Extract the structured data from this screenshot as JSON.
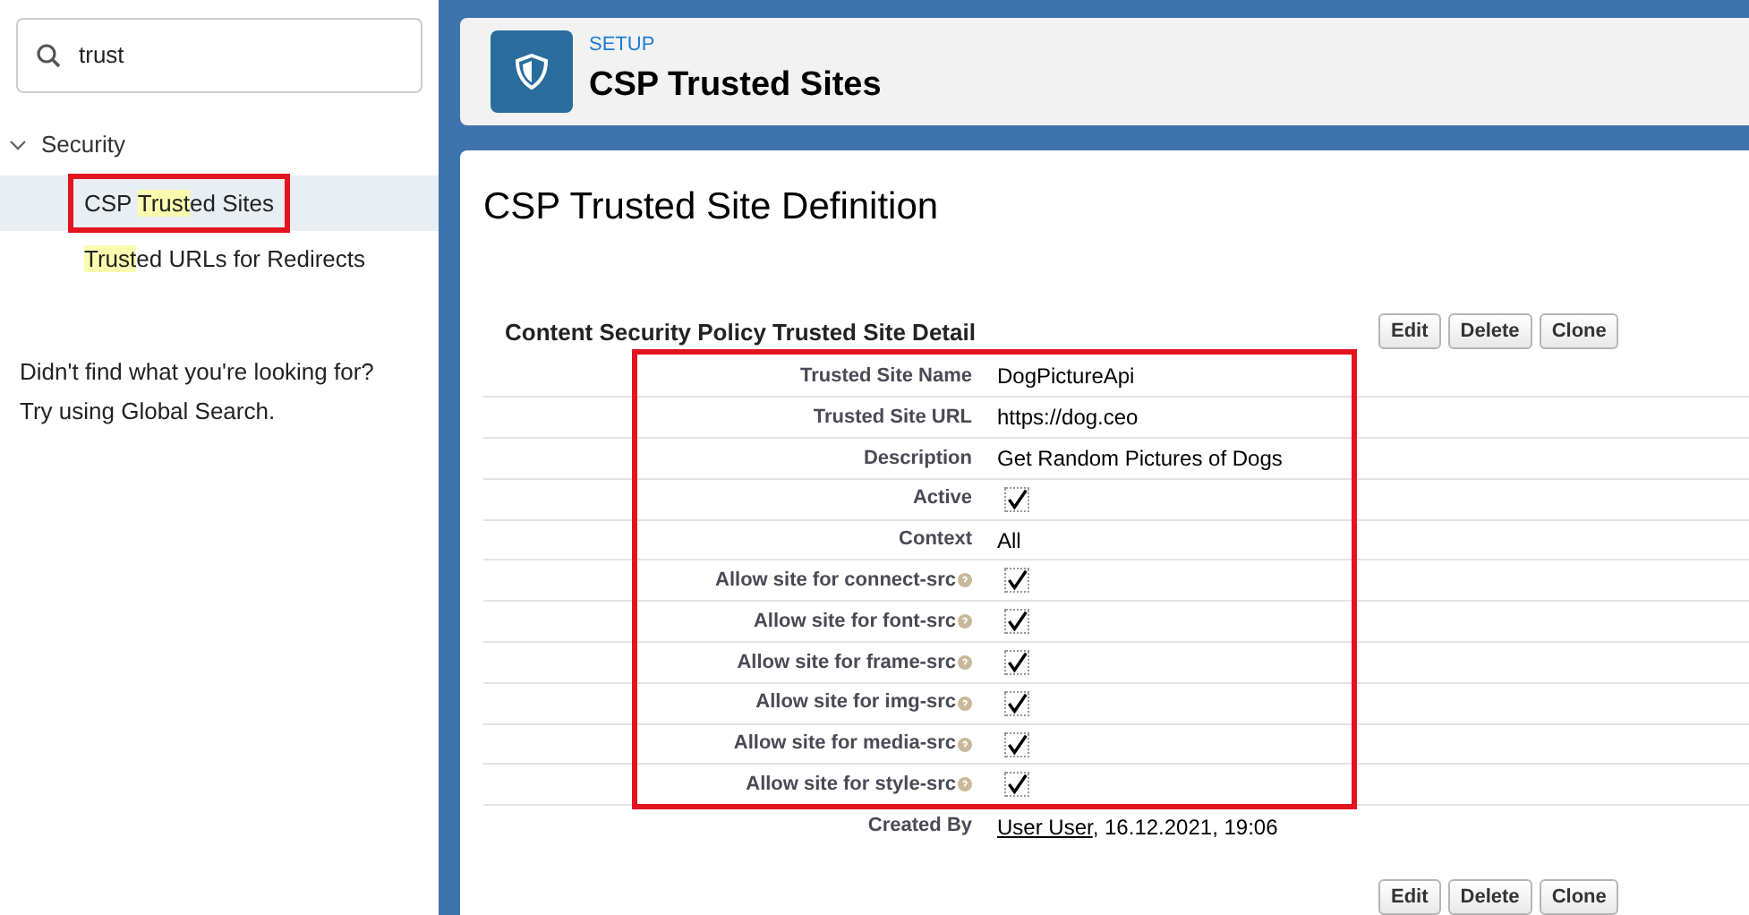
{
  "sidebar": {
    "search": {
      "value": "trust"
    },
    "tree": [
      {
        "label": "Security",
        "expanded": true,
        "children": [
          {
            "before": "CSP ",
            "match": "Trust",
            "after": "ed Sites",
            "selected": true,
            "outlined": true
          },
          {
            "match": "Trust",
            "after": "ed URLs for Redirects",
            "selected": false,
            "outlined": false
          }
        ]
      }
    ],
    "help_lines": [
      "Didn't find what you're looking for?",
      "Try using Global Search."
    ]
  },
  "header": {
    "eyebrow": "SETUP",
    "title": "CSP Trusted Sites"
  },
  "page_title": "CSP Trusted Site Definition",
  "detail": {
    "title": "Content Security Policy Trusted Site Detail",
    "buttons": [
      "Edit",
      "Delete",
      "Clone"
    ],
    "rows": [
      {
        "kind": "text",
        "label": "Trusted Site Name",
        "value": "DogPictureApi",
        "help": false,
        "outlined": true
      },
      {
        "kind": "text",
        "label": "Trusted Site URL",
        "value": "https://dog.ceo",
        "help": false,
        "outlined": true
      },
      {
        "kind": "text",
        "label": "Description",
        "value": "Get Random Pictures of Dogs",
        "help": false,
        "outlined": true
      },
      {
        "kind": "checkbox",
        "label": "Active",
        "checked": true,
        "help": false,
        "outlined": true
      },
      {
        "kind": "text",
        "label": "Context",
        "value": "All",
        "help": false,
        "outlined": true
      },
      {
        "kind": "checkbox",
        "label": "Allow site for connect-src",
        "checked": true,
        "help": true,
        "outlined": true
      },
      {
        "kind": "checkbox",
        "label": "Allow site for font-src",
        "checked": true,
        "help": true,
        "outlined": true
      },
      {
        "kind": "checkbox",
        "label": "Allow site for frame-src",
        "checked": true,
        "help": true,
        "outlined": true
      },
      {
        "kind": "checkbox",
        "label": "Allow site for img-src",
        "checked": true,
        "help": true,
        "outlined": true
      },
      {
        "kind": "checkbox",
        "label": "Allow site for media-src",
        "checked": true,
        "help": true,
        "outlined": true
      },
      {
        "kind": "checkbox",
        "label": "Allow site for style-src",
        "checked": true,
        "help": true,
        "outlined": true
      },
      {
        "kind": "created",
        "label": "Created By",
        "user": "User User",
        "value": ", 16.12.2021, 19:06",
        "help": false,
        "outlined": false
      }
    ],
    "bottom_buttons": [
      "Edit",
      "Delete",
      "Clone"
    ]
  }
}
